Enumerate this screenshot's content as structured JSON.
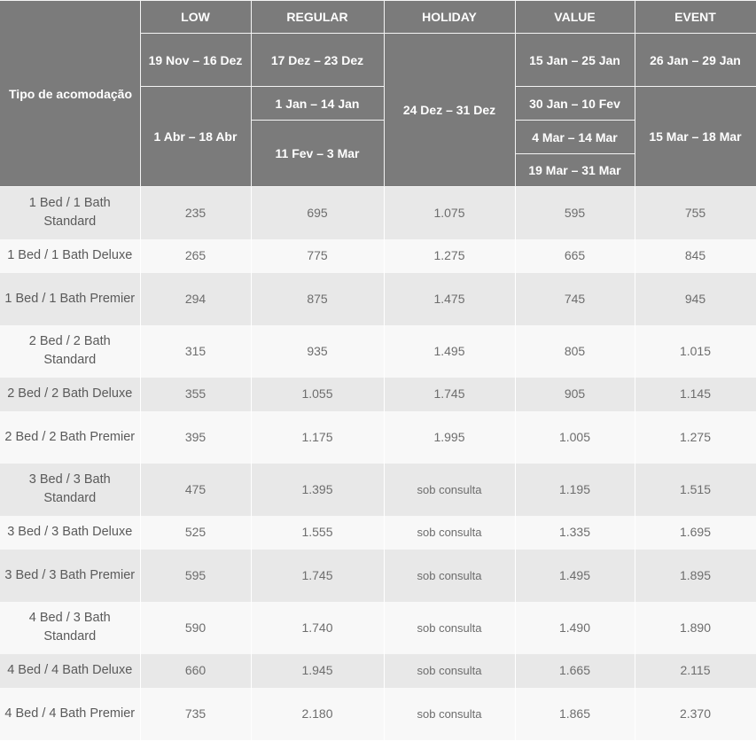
{
  "table": {
    "corner_label": "Tipo de acomodação",
    "seasons": {
      "low": "LOW",
      "regular": "REGULAR",
      "holiday": "HOLIDAY",
      "value": "VALUE",
      "event": "EVENT"
    },
    "periods": {
      "low_1": "19 Nov – 16 Dez",
      "low_2": "1 Abr – 18 Abr",
      "regular_1": "17 Dez – 23 Dez",
      "regular_2": "1 Jan – 14 Jan",
      "regular_3": "11 Fev – 3 Mar",
      "holiday_1": "24 Dez – 31 Dez",
      "value_1": "15 Jan – 25 Jan",
      "value_2": "30 Jan – 10 Fev",
      "value_3": "4 Mar – 14 Mar",
      "value_4": "19 Mar – 31 Mar",
      "event_1": "26 Jan – 29 Jan",
      "event_2": "15 Mar – 18 Mar"
    },
    "rows": [
      {
        "name": "1 Bed / 1 Bath Standard",
        "low": "235",
        "regular": "695",
        "holiday": "1.075",
        "value": "595",
        "event": "755"
      },
      {
        "name": "1 Bed / 1 Bath Deluxe",
        "low": "265",
        "regular": "775",
        "holiday": "1.275",
        "value": "665",
        "event": "845"
      },
      {
        "name": "1 Bed / 1 Bath Premier",
        "low": "294",
        "regular": "875",
        "holiday": "1.475",
        "value": "745",
        "event": "945"
      },
      {
        "name": "2 Bed / 2 Bath Standard",
        "low": "315",
        "regular": "935",
        "holiday": "1.495",
        "value": "805",
        "event": "1.015"
      },
      {
        "name": "2 Bed / 2 Bath Deluxe",
        "low": "355",
        "regular": "1.055",
        "holiday": "1.745",
        "value": "905",
        "event": "1.145"
      },
      {
        "name": "2 Bed / 2 Bath Premier",
        "low": "395",
        "regular": "1.175",
        "holiday": "1.995",
        "value": "1.005",
        "event": "1.275"
      },
      {
        "name": "3 Bed / 3 Bath Standard",
        "low": "475",
        "regular": "1.395",
        "holiday": "sob consulta",
        "value": "1.195",
        "event": "1.515"
      },
      {
        "name": "3 Bed / 3 Bath Deluxe",
        "low": "525",
        "regular": "1.555",
        "holiday": "sob consulta",
        "value": "1.335",
        "event": "1.695"
      },
      {
        "name": "3 Bed / 3 Bath Premier",
        "low": "595",
        "regular": "1.745",
        "holiday": "sob consulta",
        "value": "1.495",
        "event": "1.895"
      },
      {
        "name": "4 Bed / 3 Bath Standard",
        "low": "590",
        "regular": "1.740",
        "holiday": "sob consulta",
        "value": "1.490",
        "event": "1.890"
      },
      {
        "name": "4 Bed / 4 Bath Deluxe",
        "low": "660",
        "regular": "1.945",
        "holiday": "sob consulta",
        "value": "1.665",
        "event": "2.115"
      },
      {
        "name": "4 Bed / 4 Bath Premier",
        "low": "735",
        "regular": "2.180",
        "holiday": "sob consulta",
        "value": "1.865",
        "event": "2.370"
      }
    ]
  }
}
